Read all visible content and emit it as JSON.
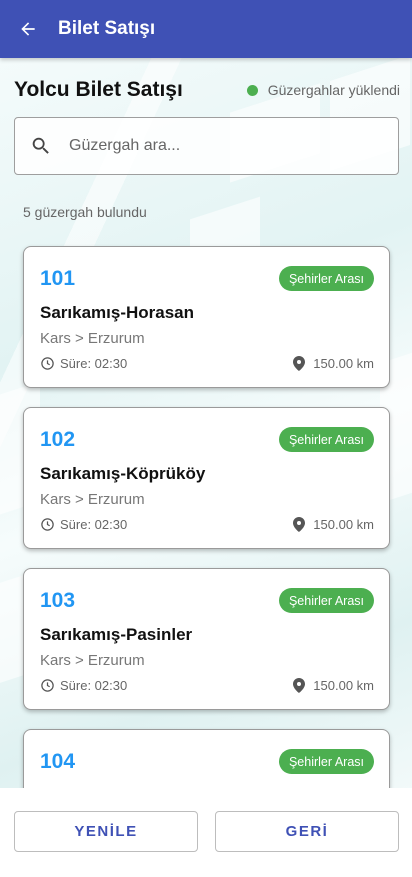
{
  "appbar": {
    "title": "Bilet Satışı"
  },
  "page": {
    "title": "Yolcu Bilet Satışı",
    "status_text": "Güzergahlar yüklendi",
    "status_color": "#4caf50"
  },
  "search": {
    "placeholder": "Güzergah ara...",
    "value": ""
  },
  "results_count_text": "5 güzergah bulundu",
  "routes": [
    {
      "number": "101",
      "badge": "Şehirler Arası",
      "name": "Sarıkamış-Horasan",
      "route": "Kars > Erzurum",
      "duration": "Süre: 02:30",
      "distance": "150.00 km"
    },
    {
      "number": "102",
      "badge": "Şehirler Arası",
      "name": "Sarıkamış-Köprüköy",
      "route": "Kars > Erzurum",
      "duration": "Süre: 02:30",
      "distance": "150.00 km"
    },
    {
      "number": "103",
      "badge": "Şehirler Arası",
      "name": "Sarıkamış-Pasinler",
      "route": "Kars > Erzurum",
      "duration": "Süre: 02:30",
      "distance": "150.00 km"
    },
    {
      "number": "104",
      "badge": "Şehirler Arası",
      "name": "",
      "route": "",
      "duration": "",
      "distance": ""
    }
  ],
  "buttons": {
    "refresh": "YENİLE",
    "back": "GERİ"
  },
  "colors": {
    "primary": "#3f51b5",
    "accent": "#2196f3",
    "success": "#4caf50"
  }
}
